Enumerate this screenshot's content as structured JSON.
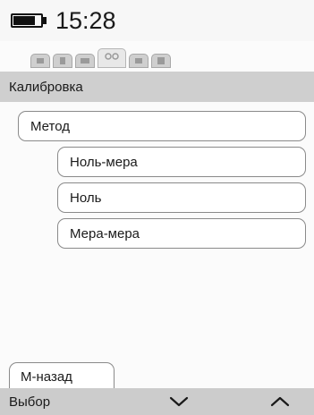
{
  "status_bar": {
    "time": "15:28",
    "battery_level": 0.8
  },
  "tabs": {
    "icons": [
      "tab-icon-1",
      "tab-icon-2",
      "tab-icon-3",
      "link-icon",
      "tab-icon-5",
      "tab-icon-6"
    ],
    "active_index": 3
  },
  "title": "Калибровка",
  "menu": {
    "method_label": "Метод",
    "options": [
      "Ноль-мера",
      "Ноль",
      "Мера-мера"
    ]
  },
  "back_tab_label": "М-назад",
  "softkeys": {
    "select_label": "Выбор",
    "down_icon": "chevron-down-icon",
    "up_icon": "chevron-up-icon"
  },
  "colors": {
    "title_bar": "#cfcfcf",
    "softkey_bar": "#cccccc",
    "border": "#8a8a8a"
  }
}
